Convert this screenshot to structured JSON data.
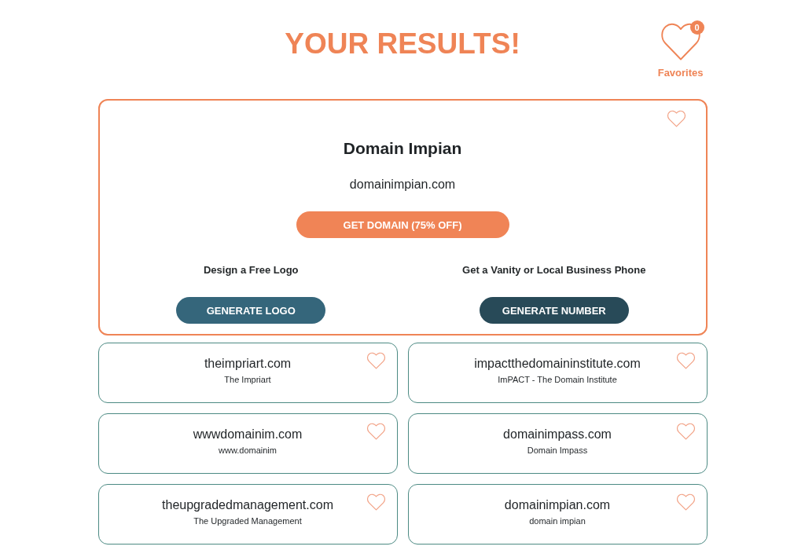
{
  "header": {
    "title": "YOUR RESULTS!",
    "favorites": {
      "label": "Favorites",
      "count": "0"
    }
  },
  "featured": {
    "name": "Domain Impian",
    "domain": "domainimpian.com",
    "favorited": false,
    "get_button": "GET DOMAIN (75% OFF)",
    "offers": [
      {
        "kind": "logo",
        "label": "Design a Free Logo",
        "button": "GENERATE LOGO"
      },
      {
        "kind": "phone",
        "label": "Get a Vanity or Local Business Phone",
        "button": "GENERATE NUMBER"
      }
    ]
  },
  "results": [
    {
      "domain": "theimpriart.com",
      "name": "The Impriart",
      "favorited": false
    },
    {
      "domain": "impactthedomaininstitute.com",
      "name": "ImPACT - The Domain Institute",
      "favorited": false
    },
    {
      "domain": "wwwdomainim.com",
      "name": "www.domainim",
      "favorited": false
    },
    {
      "domain": "domainimpass.com",
      "name": "Domain Impass",
      "favorited": false
    },
    {
      "domain": "theupgradedmanagement.com",
      "name": "The Upgraded Management",
      "favorited": false
    },
    {
      "domain": "domainimpian.com",
      "name": "domain impian",
      "favorited": false
    }
  ]
}
